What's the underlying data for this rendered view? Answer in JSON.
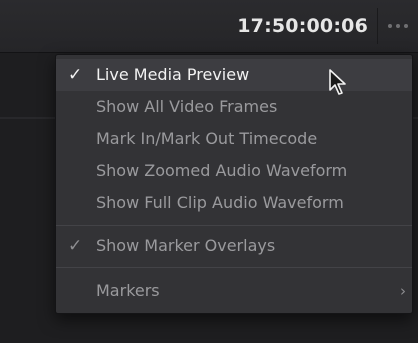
{
  "topbar": {
    "timecode": "17:50:00:06",
    "more_icon": "ellipsis-icon"
  },
  "menu": {
    "items": [
      {
        "label": "Live Media Preview",
        "checked": true,
        "highlighted": true
      },
      {
        "label": "Show All Video Frames",
        "checked": false
      },
      {
        "label": "Mark In/Mark Out Timecode",
        "checked": false
      },
      {
        "label": "Show Zoomed Audio Waveform",
        "checked": false
      },
      {
        "label": "Show Full Clip Audio Waveform",
        "checked": false
      },
      {
        "label": "Show Marker Overlays",
        "checked": true
      },
      {
        "label": "Markers",
        "submenu": true
      }
    ],
    "check_glyph": "✓",
    "chevron_glyph": "›"
  },
  "colors": {
    "menu_bg": "#333336",
    "highlight_bg": "#3d3d41",
    "text_dim": "#9a9a9d",
    "text_active": "#f2f2f2"
  }
}
